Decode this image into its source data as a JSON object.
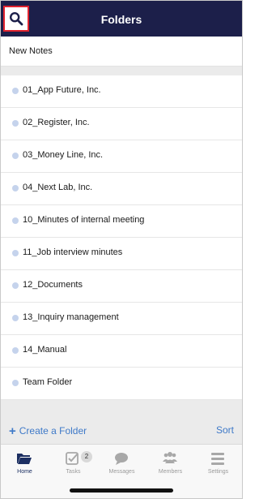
{
  "header": {
    "title": "Folders",
    "search_icon": "search-icon",
    "highlight_color": "#e0232f",
    "background": "#1c1f4a"
  },
  "new_notes": {
    "label": "New Notes"
  },
  "folders": [
    {
      "label": "01_App Future, Inc."
    },
    {
      "label": "02_Register, Inc."
    },
    {
      "label": "03_Money Line, Inc."
    },
    {
      "label": "04_Next Lab, Inc."
    },
    {
      "label": "10_Minutes of internal meeting"
    },
    {
      "label": "11_Job interview minutes"
    },
    {
      "label": "12_Documents"
    },
    {
      "label": "13_Inquiry management"
    },
    {
      "label": "14_Manual"
    },
    {
      "label": "Team Folder"
    }
  ],
  "actions": {
    "create_folder_label": "Create a Folder",
    "sort_label": "Sort",
    "accent_color": "#3e79c8"
  },
  "tabbar": {
    "tabs": [
      {
        "label": "Home",
        "icon": "folder-open-icon",
        "active": true
      },
      {
        "label": "Tasks",
        "icon": "checkbox-icon",
        "badge": "2"
      },
      {
        "label": "Messages",
        "icon": "chat-bubble-icon"
      },
      {
        "label": "Members",
        "icon": "people-icon"
      },
      {
        "label": "Settings",
        "icon": "menu-icon"
      }
    ],
    "active_color": "#1c2f62"
  }
}
